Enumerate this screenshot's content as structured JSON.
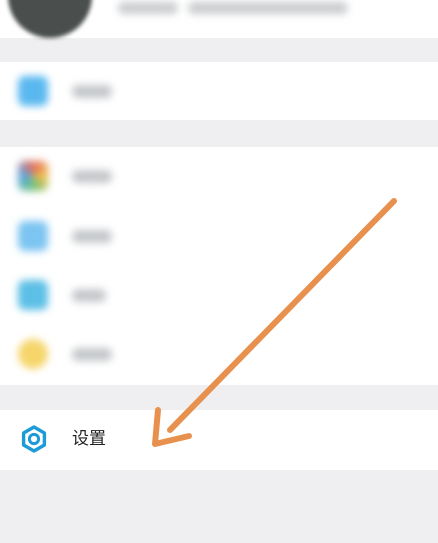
{
  "settings": {
    "label": "设置",
    "icon": "gear-icon",
    "icon_color": "#1d9bd7"
  },
  "blurred_items": [
    {
      "icon_color": "#5ab8f0"
    },
    {
      "icon_color": "#e8a05a"
    },
    {
      "icon_color": "#7cc4f2"
    },
    {
      "icon_color": "#5cbfe6"
    },
    {
      "icon_color": "#f6d56a"
    }
  ],
  "annotation": {
    "arrow_color": "#e8914f"
  }
}
